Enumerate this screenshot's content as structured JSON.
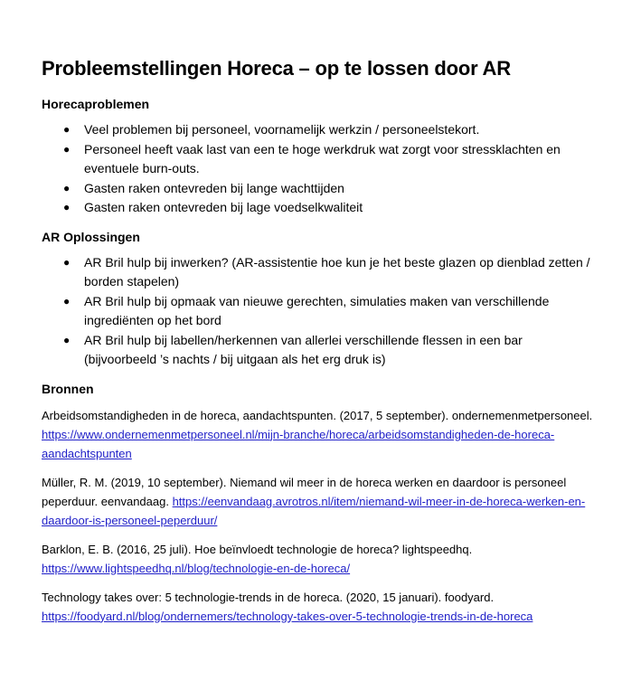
{
  "title": "Probleemstellingen Horeca – op te lossen door AR",
  "sections": {
    "problems": {
      "heading": "Horecaproblemen",
      "items": [
        "Veel problemen bij personeel, voornamelijk werkzin / personeelstekort.",
        "Personeel heeft vaak last van een te hoge werkdruk wat zorgt voor stressklachten en eventuele burn-outs.",
        "Gasten raken ontevreden bij lange wachttijden",
        "Gasten raken ontevreden bij lage voedselkwaliteit"
      ]
    },
    "solutions": {
      "heading": "AR Oplossingen",
      "items": [
        "AR Bril hulp bij inwerken? (AR-assistentie hoe kun je het beste glazen op dienblad zetten / borden stapelen)",
        "AR Bril hulp bij opmaak van nieuwe gerechten, simulaties maken van verschillende ingrediënten op het bord",
        "AR Bril hulp bij labellen/herkennen van allerlei verschillende flessen in een bar (bijvoorbeeld ’s nachts / bij uitgaan als het erg druk is)"
      ]
    },
    "sources": {
      "heading": "Bronnen",
      "refs": [
        {
          "text": "Arbeidsomstandigheden in de horeca, aandachtspunten. (2017, 5 september). ondernemenmetpersoneel. ",
          "link": "https://www.ondernemenmetpersoneel.nl/mijn-branche/horeca/arbeidsomstandigheden-de-horeca-aandachtspunten"
        },
        {
          "text": "Müller, R. M. (2019, 10 september). Niemand wil meer in de horeca werken en daardoor is personeel peperduur. eenvandaag. ",
          "link": "https://eenvandaag.avrotros.nl/item/niemand-wil-meer-in-de-horeca-werken-en-daardoor-is-personeel-peperduur/"
        },
        {
          "text": "Barklon, E. B. (2016, 25 juli). Hoe beïnvloedt technologie de horeca? lightspeedhq. ",
          "link": "https://www.lightspeedhq.nl/blog/technologie-en-de-horeca/"
        },
        {
          "text": "Technology takes over: 5 technologie-trends in de horeca. (2020, 15 januari). foodyard. ",
          "link": "https://foodyard.nl/blog/ondernemers/technology-takes-over-5-technologie-trends-in-de-horeca"
        }
      ]
    }
  },
  "bullet_symbol": "●",
  "colors": {
    "link": "#1f1fc8",
    "text": "#000000"
  }
}
